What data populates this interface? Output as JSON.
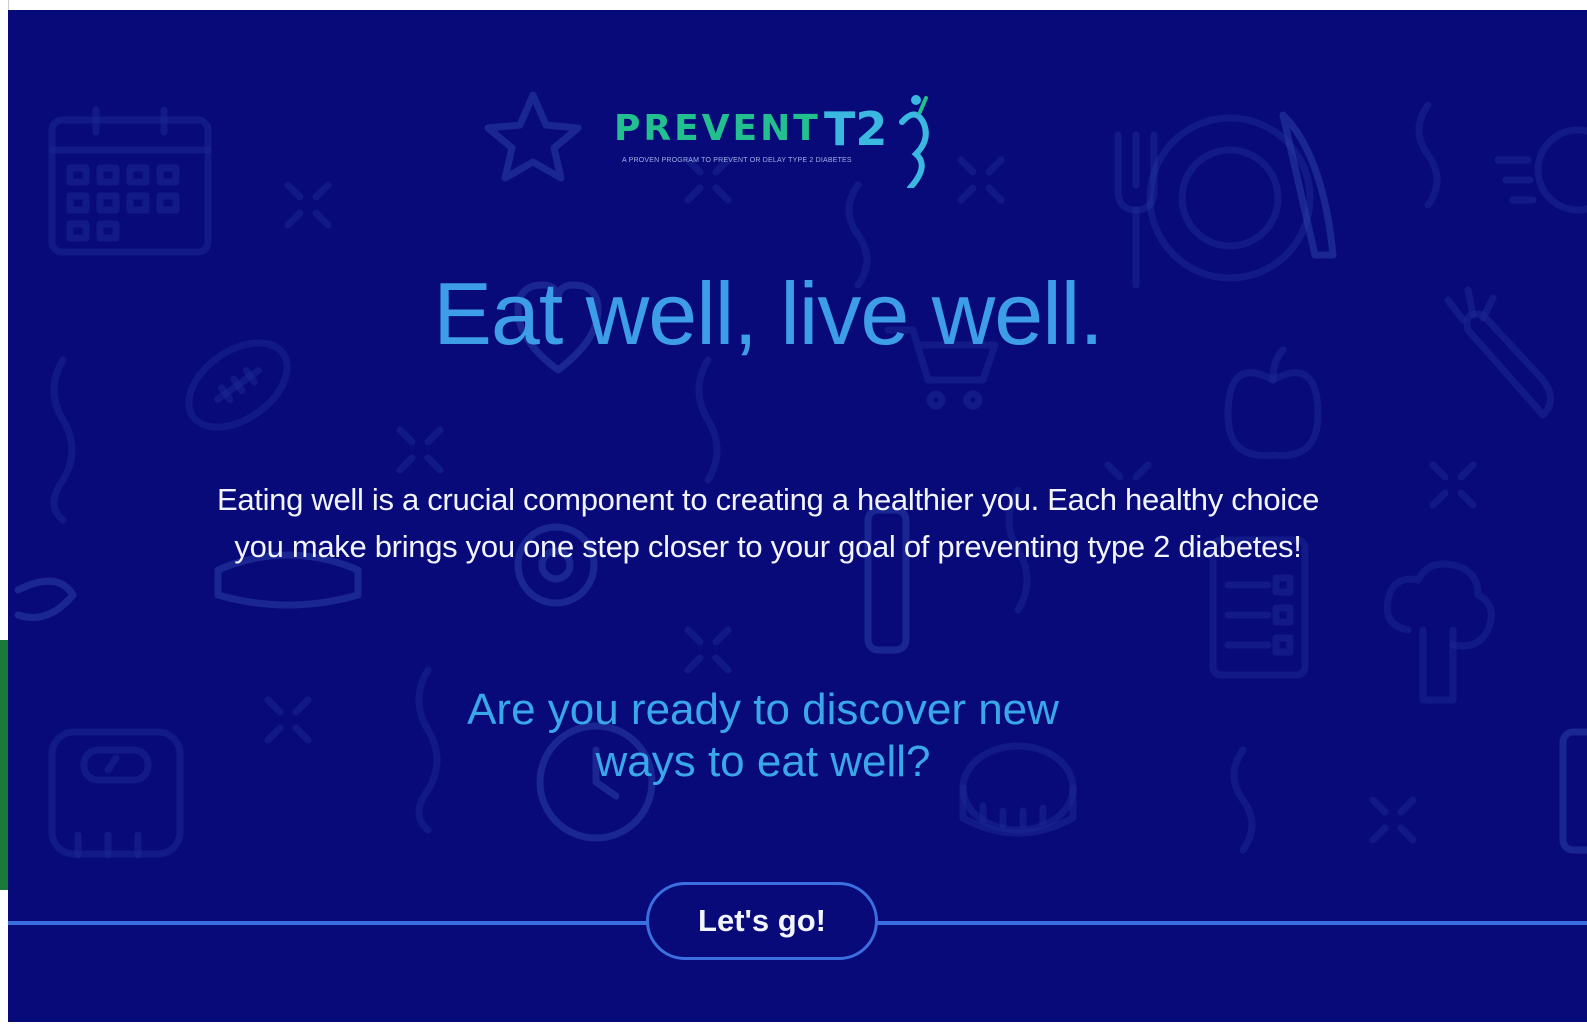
{
  "colors": {
    "background": "#080a7a",
    "accent_blue": "#3d9de6",
    "logo_green": "#22c08f",
    "line_blue": "#3b6fe0"
  },
  "logo": {
    "word": "PREVENT",
    "suffix": "T2",
    "tagline": "A PROVEN PROGRAM TO PREVENT OR DELAY TYPE 2 DIABETES",
    "icon": "person-figure-icon"
  },
  "hero": {
    "headline": "Eat well, live well.",
    "body": "Eating well is a crucial component to creating a healthier you. Each healthy choice you make brings you one step closer to your goal of preventing type 2 diabetes!",
    "question": "Are you ready to discover new ways to eat well?"
  },
  "cta": {
    "label": "Let's go!"
  },
  "background_icons": [
    "calendar-icon",
    "star-icon",
    "fork-icon",
    "plate-icon",
    "knife-icon",
    "football-icon",
    "heart-icon",
    "shopping-cart-icon",
    "apple-icon",
    "carrot-icon",
    "scale-icon",
    "stopwatch-icon",
    "tape-measure-icon",
    "checklist-icon",
    "broccoli-icon",
    "squiggle-icon",
    "sparkle-icon"
  ]
}
